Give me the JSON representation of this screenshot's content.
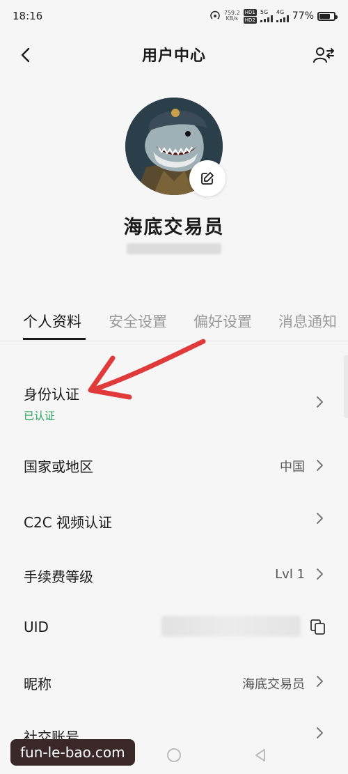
{
  "status_bar": {
    "time": "18:16",
    "net_speed_value": "759.2",
    "net_speed_unit": "KB/s",
    "hd1": "HD1",
    "hd2": "HD2",
    "sig1": "5G",
    "sig2": "4G",
    "battery": "77%",
    "battery_level": 0.77
  },
  "header": {
    "title": "用户中心",
    "back_icon": "chevron-left-icon",
    "right_icon": "user-switch-icon"
  },
  "profile": {
    "nickname": "海底交易员",
    "avatar_icon": "shark-avatar",
    "edit_icon": "edit-icon"
  },
  "tabs": [
    {
      "label": "个人资料",
      "active": true
    },
    {
      "label": "安全设置",
      "active": false
    },
    {
      "label": "偏好设置",
      "active": false
    },
    {
      "label": "消息通知",
      "active": false
    }
  ],
  "rows": {
    "identity": {
      "label": "身份认证",
      "status": "已认证"
    },
    "country": {
      "label": "国家或地区",
      "value": "中国"
    },
    "c2c_video": {
      "label": "C2C 视频认证"
    },
    "fee_level": {
      "label": "手续费等级",
      "value": "Lvl 1"
    },
    "uid": {
      "label": "UID",
      "copy_icon": "copy-icon"
    },
    "nickname": {
      "label": "昵称",
      "value": "海底交易员"
    },
    "social": {
      "label": "社交账号"
    }
  },
  "annotation": {
    "color": "#e03a3a"
  },
  "watermark": "fun-le-bao.com",
  "colors": {
    "verified": "#27a35a",
    "background": "#f6f6f6"
  }
}
